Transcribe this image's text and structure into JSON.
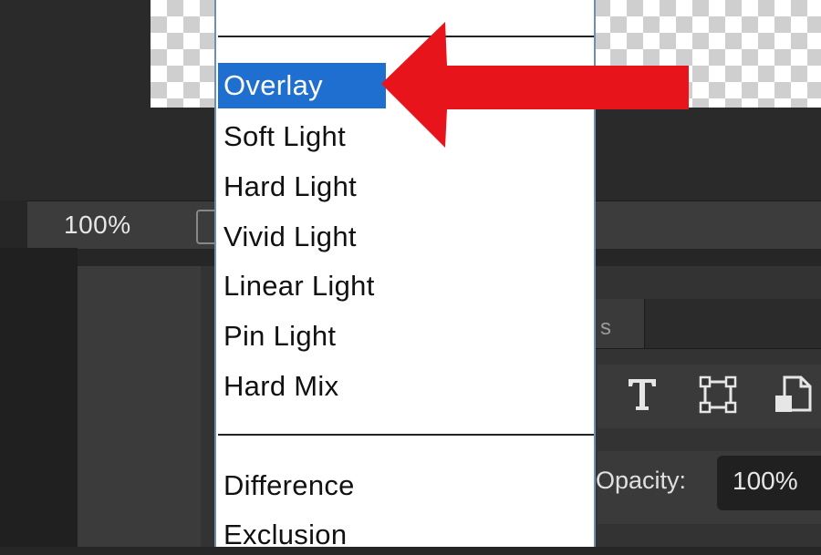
{
  "status_bar": {
    "zoom": "100%"
  },
  "blend_menu": {
    "items": [
      "Overlay",
      "Soft Light",
      "Hard Light",
      "Vivid Light",
      "Linear Light",
      "Pin Light",
      "Hard Mix",
      "Difference",
      "Exclusion"
    ],
    "selected": "Overlay"
  },
  "layers_panel": {
    "tab_partial": "s",
    "tool_icons": [
      "type-tool-icon",
      "transform-icon",
      "smart-object-icon"
    ],
    "opacity_label": "Opacity:",
    "opacity_value": "100%"
  },
  "colors": {
    "selection": "#1e6fd0",
    "arrow": "#e8141b"
  }
}
